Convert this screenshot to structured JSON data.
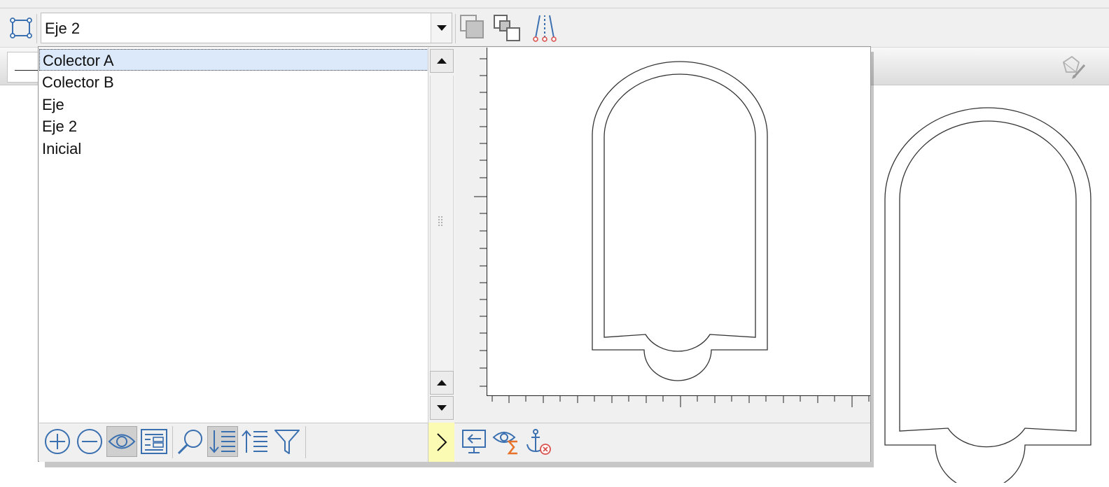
{
  "toolbar": {
    "selector_value": "Eje 2",
    "icons": [
      "polyline-icon",
      "dropdown-arrow-icon",
      "bring-front-icon",
      "send-back-icon",
      "parallel-axes-icon"
    ]
  },
  "toolbar2": {
    "line_style_icon": "line-style-icon",
    "pencil_icon": "shape-pencil-icon"
  },
  "dropdown": {
    "items": [
      {
        "label": "Colector A",
        "selected": true
      },
      {
        "label": "Colector B",
        "selected": false
      },
      {
        "label": "Eje",
        "selected": false
      },
      {
        "label": "Eje 2",
        "selected": false
      },
      {
        "label": "Inicial",
        "selected": false
      }
    ],
    "list_toolbar_icons": [
      "add-icon",
      "remove-icon",
      "visibility-icon",
      "details-icon",
      "search-icon",
      "sort-descending-icon",
      "sort-ascending-icon",
      "filter-icon"
    ],
    "expand_icon": "chevron-right-icon",
    "preview_toolbar_icons": [
      "import-icon",
      "visibility-sum-icon",
      "anchor-remove-icon"
    ]
  },
  "colors": {
    "accent_blue": "#3a6fb0",
    "accent_orange": "#e8722a",
    "accent_red": "#d9534f",
    "selection": "#dbe9fa",
    "expander": "#fbfbb4"
  }
}
